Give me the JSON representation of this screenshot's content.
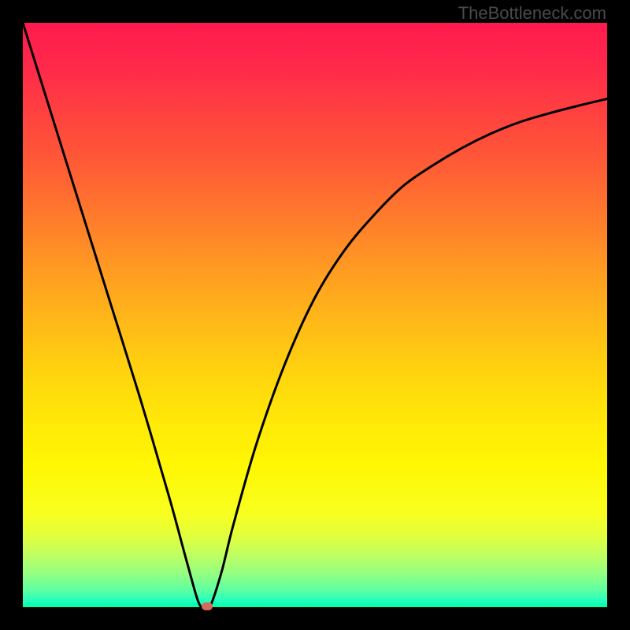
{
  "attribution": "TheBottleneck.com",
  "colors": {
    "frame": "#000000",
    "curve": "#000000",
    "marker": "#d96a5b",
    "gradient_top": "#ff1a4d",
    "gradient_bottom": "#00ff9f"
  },
  "chart_data": {
    "type": "line",
    "title": "",
    "xlabel": "",
    "ylabel": "",
    "xlim": [
      0,
      100
    ],
    "ylim": [
      0,
      100
    ],
    "notes": "V-shaped bottleneck curve with gradient heatmap background running from red (top / high bottleneck) to green (bottom / no bottleneck). No visible axis ticks or labels; values estimated from pixel positions.",
    "series": [
      {
        "name": "bottleneck-curve",
        "x": [
          0,
          5,
          10,
          15,
          20,
          25,
          28,
          30,
          31,
          32,
          34,
          36,
          40,
          45,
          50,
          55,
          60,
          65,
          70,
          75,
          80,
          85,
          90,
          95,
          100
        ],
        "y": [
          100,
          84,
          68,
          52,
          36,
          19,
          8,
          1,
          0,
          0,
          6,
          14,
          28,
          42,
          53,
          61,
          67,
          72,
          75.5,
          78.5,
          81,
          83,
          84.5,
          85.8,
          87
        ]
      }
    ],
    "marker_point": {
      "x": 31.5,
      "y": 0
    }
  }
}
